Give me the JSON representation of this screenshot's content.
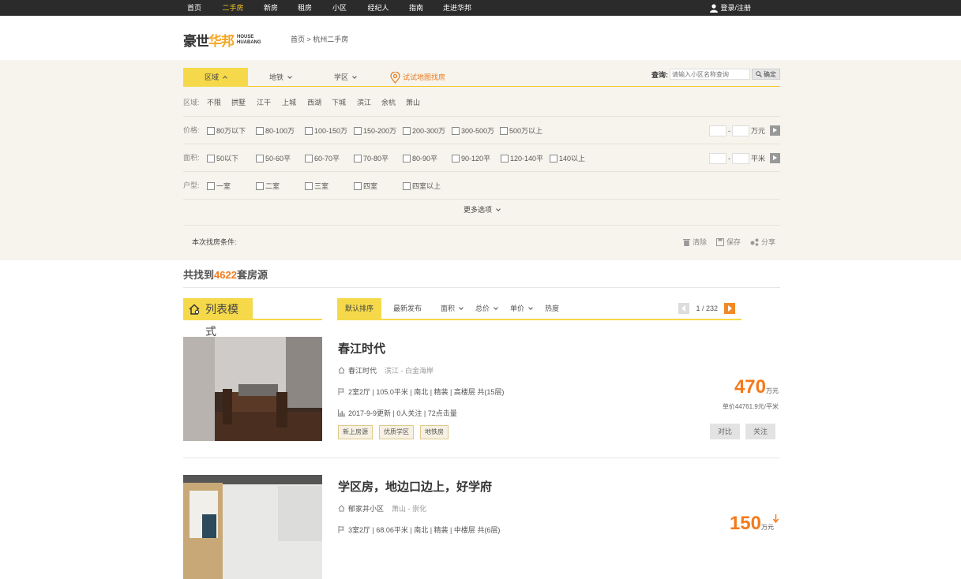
{
  "topnav": {
    "items": [
      "首页",
      "二手房",
      "新房",
      "租房",
      "小区",
      "经纪人",
      "指南",
      "走进华邦"
    ],
    "login": "登录/注册"
  },
  "header": {
    "logo_cn_part1": "豪世",
    "logo_cn_part2": "华邦",
    "logo_en_1": "HOUSE",
    "logo_en_2": "HUABANG",
    "breadcrumb": "首页 > 杭州二手房"
  },
  "filter": {
    "tabs": [
      "区域",
      "地铁",
      "学区"
    ],
    "map_link": "试试地图找房",
    "query_label": "查询:",
    "query_placeholder": "请输入小区名称查询",
    "query_button": "确定",
    "district_label": "区域:",
    "districts": [
      "不限",
      "拱墅",
      "江干",
      "上城",
      "西湖",
      "下城",
      "滨江",
      "余杭",
      "萧山"
    ],
    "price_label": "价格:",
    "prices": [
      "80万以下",
      "80-100万",
      "100-150万",
      "150-200万",
      "200-300万",
      "300-500万",
      "500万以上"
    ],
    "price_unit": "万元",
    "area_label": "面积:",
    "areas": [
      "50以下",
      "50-60平",
      "60-70平",
      "70-80平",
      "80-90平",
      "90-120平",
      "120-140平",
      "140以上"
    ],
    "area_unit": "平米",
    "layout_label": "户型:",
    "layouts": [
      "一室",
      "二室",
      "三室",
      "四室",
      "四室以上"
    ],
    "dash": "-",
    "more": "更多选项",
    "conditions_label": "本次找房条件:",
    "actions": [
      "清除",
      "保存",
      "分享"
    ]
  },
  "results": {
    "prefix": "共找到",
    "count": "4622",
    "suffix": "套房源"
  },
  "mode": {
    "title": "列表模式"
  },
  "sortbar": {
    "items": [
      "默认排序",
      "最新发布",
      "面积",
      "总价",
      "单价",
      "热度"
    ],
    "page": "1 / 232"
  },
  "listings": [
    {
      "title": "春江时代",
      "community": "春江时代",
      "location": "滨江 - 白金海岸",
      "info": "2室2厅 | 105.0平米 | 南北 | 精装 | 高楼层 共(15层)",
      "update": "2017-9-9更新 | 0人关注 | 72点击量",
      "tags": [
        "新上房源",
        "优质学区",
        "地铁房"
      ],
      "price": "470",
      "price_unit": "万元",
      "unit_price": "单价44761.9元/平米",
      "compare": "对比",
      "follow": "关注"
    },
    {
      "title": "学区房，地边口边上，好学府",
      "community": "郁家井小区",
      "location": "萧山 - 崇化",
      "info": "3室2厅 | 68.06平米 | 南北 | 精装 | 中楼层 共(6层)",
      "price": "150",
      "price_unit": "万元"
    }
  ]
}
